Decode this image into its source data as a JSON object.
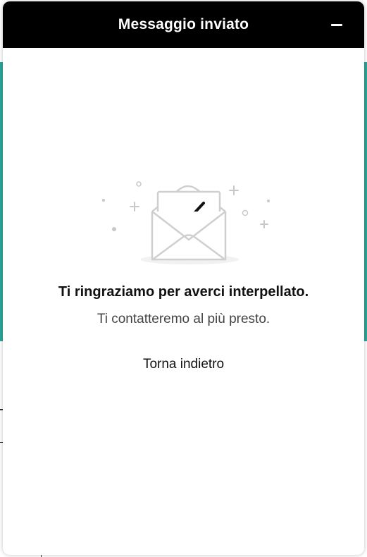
{
  "widget": {
    "title": "Messaggio inviato",
    "minimize_icon": "minus-icon"
  },
  "confirmation": {
    "illustration_icon": "envelope-check-icon",
    "title": "Ti ringraziamo per averci interpellato.",
    "subtitle": "Ti contatteremo al più presto.",
    "back_label": "Torna indietro"
  },
  "colors": {
    "header_bg": "#000000",
    "header_text": "#ffffff",
    "background_accent": "#2aa69a"
  }
}
